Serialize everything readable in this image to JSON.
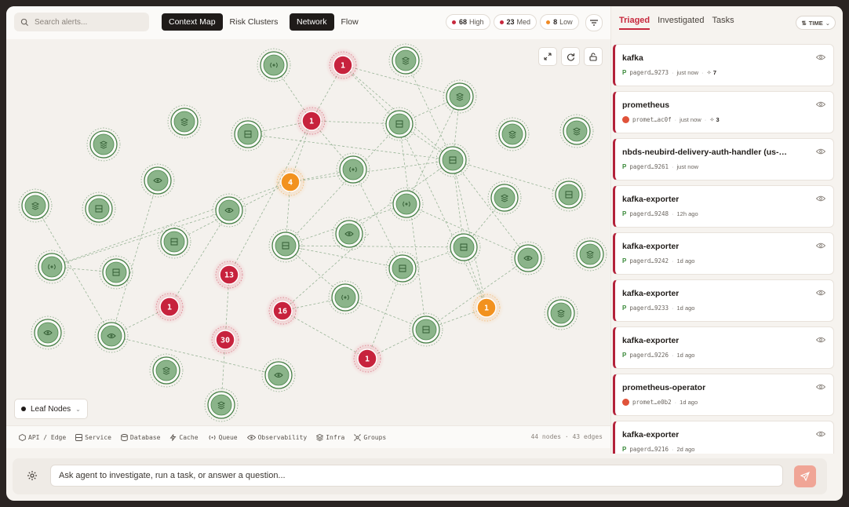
{
  "search": {
    "placeholder": "Search alerts..."
  },
  "view_toggle": {
    "options": [
      "Context Map",
      "Risk Clusters"
    ],
    "active": "Context Map"
  },
  "layout_toggle": {
    "options": [
      "Network",
      "Flow"
    ],
    "active": "Network"
  },
  "severity": [
    {
      "count": "68",
      "label": "High",
      "color": "#c7283d"
    },
    {
      "count": "23",
      "label": "Med",
      "color": "#c7283d"
    },
    {
      "count": "8",
      "label": "Low",
      "color": "#f08a24"
    }
  ],
  "leaf_nodes": {
    "label": "Leaf Nodes"
  },
  "legend": {
    "items": [
      "API / Edge",
      "Service",
      "Database",
      "Cache",
      "Queue",
      "Observability",
      "Infra",
      "Groups"
    ],
    "counts": "44 nodes · 43 edges"
  },
  "graph": {
    "alerts": [
      {
        "value": "1",
        "severity": "high"
      },
      {
        "value": "1",
        "severity": "high"
      },
      {
        "value": "4",
        "severity": "med"
      },
      {
        "value": "13",
        "severity": "high"
      },
      {
        "value": "1",
        "severity": "high"
      },
      {
        "value": "16",
        "severity": "high"
      },
      {
        "value": "30",
        "severity": "high"
      },
      {
        "value": "1",
        "severity": "high"
      },
      {
        "value": "1",
        "severity": "med"
      }
    ]
  },
  "panel": {
    "tabs": [
      "Triaged",
      "Investigated",
      "Tasks"
    ],
    "active_tab": "Triaged",
    "sort_label": "TIME",
    "alerts": [
      {
        "title": "kafka",
        "source": "pagerduty",
        "id": "pagerd…9273",
        "time": "just now",
        "count": "7"
      },
      {
        "title": "prometheus",
        "source": "prometheus",
        "id": "promet…ac0f",
        "time": "just now",
        "count": "3"
      },
      {
        "title": "nbds-neubird-delivery-auth-handler (us-…",
        "source": "pagerduty",
        "id": "pagerd…9261",
        "time": "just now",
        "count": ""
      },
      {
        "title": "kafka-exporter",
        "source": "pagerduty",
        "id": "pagerd…9248",
        "time": "12h ago",
        "count": ""
      },
      {
        "title": "kafka-exporter",
        "source": "pagerduty",
        "id": "pagerd…9242",
        "time": "1d ago",
        "count": ""
      },
      {
        "title": "kafka-exporter",
        "source": "pagerduty",
        "id": "pagerd…9233",
        "time": "1d ago",
        "count": ""
      },
      {
        "title": "kafka-exporter",
        "source": "pagerduty",
        "id": "pagerd…9226",
        "time": "1d ago",
        "count": ""
      },
      {
        "title": "prometheus-operator",
        "source": "prometheus",
        "id": "promet…e0b2",
        "time": "1d ago",
        "count": ""
      },
      {
        "title": "kafka-exporter",
        "source": "pagerduty",
        "id": "pagerd…9216",
        "time": "2d ago",
        "count": ""
      }
    ]
  },
  "composer": {
    "placeholder": "Ask agent to investigate, run a task, or answer a question..."
  }
}
